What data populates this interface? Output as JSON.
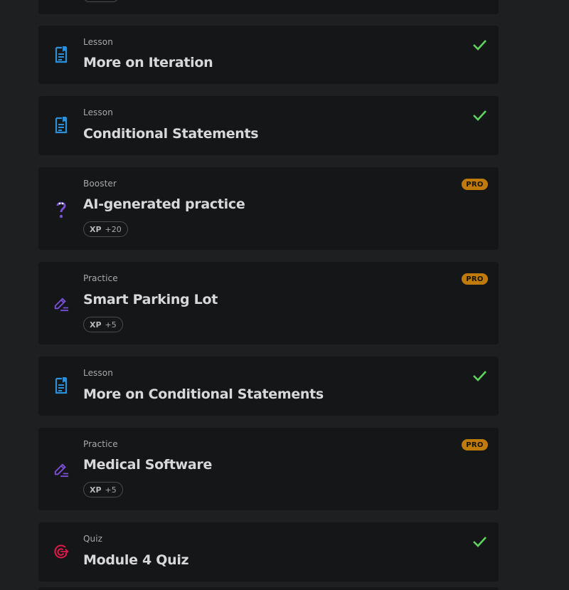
{
  "colors": {
    "background": "#1e1f21",
    "card": "#151618",
    "lesson_icon": "#2b8fd9",
    "booster_icon": "#7a4fd6",
    "practice_icon": "#7a4fd6",
    "quiz_icon": "#e0194a",
    "check": "#5fd35f",
    "pro_badge": "#c07a0a"
  },
  "items": [
    {
      "type": "Lesson",
      "title": "More on Iteration",
      "icon": "document-icon",
      "completed": true
    },
    {
      "type": "Lesson",
      "title": "Conditional Statements",
      "icon": "document-icon",
      "completed": true
    },
    {
      "type": "Booster",
      "title": "AI-generated practice",
      "icon": "question-mark-icon",
      "badge": "PRO",
      "xp_label": "XP",
      "xp_value": "+20"
    },
    {
      "type": "Practice",
      "title": "Smart Parking Lot",
      "icon": "pencil-icon",
      "badge": "PRO",
      "xp_label": "XP",
      "xp_value": "+5"
    },
    {
      "type": "Lesson",
      "title": "More on Conditional Statements",
      "icon": "document-icon",
      "completed": true
    },
    {
      "type": "Practice",
      "title": "Medical Software",
      "icon": "pencil-icon",
      "badge": "PRO",
      "xp_label": "XP",
      "xp_value": "+5"
    },
    {
      "type": "Quiz",
      "title": "Module 4 Quiz",
      "icon": "target-icon",
      "completed": true
    }
  ]
}
